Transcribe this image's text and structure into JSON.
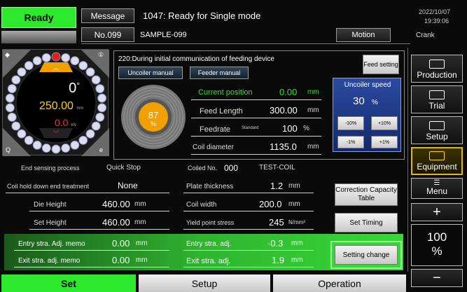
{
  "header": {
    "status": "Ready",
    "message_label": "Message",
    "message_text": "1047: Ready for Single mode",
    "date": "2022/10/07",
    "time": "19:39:06",
    "program_no": "No.099",
    "program_name": "SAMPLE-099",
    "motion_label": "Motion",
    "motion_value": "Crank"
  },
  "gauge": {
    "angle": "0",
    "angle_unit": "°",
    "position": "250.00",
    "position_unit": "mm",
    "load": "0.0",
    "load_unit": "kN",
    "percent": "87",
    "percent_unit": "%"
  },
  "feed": {
    "comm_message": "220:During initial communication of feeding device",
    "uncoiler_manual": "Uncoiler manual",
    "feeder_manual": "Feeder manual",
    "feed_setting": "Feed setting",
    "current_position_label": "Current position",
    "current_position": "0.00",
    "current_position_unit": "mm",
    "feed_length_label": "Feed Length",
    "feed_length": "300.00",
    "feed_length_unit": "mm",
    "feedrate_label": "Feedrate",
    "feedrate_mode": "Standard",
    "feedrate": "100",
    "feedrate_unit": "%",
    "coil_diameter_label": "Coil diameter",
    "coil_diameter": "1135.0",
    "coil_diameter_unit": "mm"
  },
  "uncoiler": {
    "title": "Uncoiler speed",
    "value": "30",
    "unit": "%",
    "btn_m10": "-10%",
    "btn_p10": "+10%",
    "btn_m1": "-1%",
    "btn_p1": "+1%"
  },
  "left_params": {
    "end_sensing_label": "End sensing process",
    "end_sensing": "Quick Stop",
    "coil_hold_label": "Coil hold down end treatment",
    "coil_hold": "None",
    "die_height_label": "Die Height",
    "die_height": "460.00",
    "die_height_unit": "mm",
    "set_height_label": "Set Height",
    "set_height": "460.00",
    "set_height_unit": "mm",
    "entry_memo_label": "Entry stra. Adj. memo",
    "entry_memo": "0.00",
    "entry_memo_unit": "mm",
    "exit_memo_label": "Exit stra. adj. memo",
    "exit_memo": "0.00",
    "exit_memo_unit": "mm"
  },
  "right_params": {
    "coiled_no_label": "Coiled No.",
    "coiled_no": "000",
    "coiled_name": "TEST-COIL",
    "plate_thickness_label": "Plate thickness",
    "plate_thickness": "1.2",
    "plate_thickness_unit": "mm",
    "coil_width_label": "Coil width",
    "coil_width": "200.0",
    "coil_width_unit": "mm",
    "yield_label": "Yield point stress",
    "yield": "245",
    "yield_unit": "N/mm²",
    "entry_adj_label": "Entry stra. adj.",
    "entry_adj": "-0.3",
    "entry_adj_unit": "mm",
    "exit_adj_label": "Exit stra. adj.",
    "exit_adj": "1.9",
    "exit_adj_unit": "mm"
  },
  "actions": {
    "correction": "Correction Capacity Table",
    "set_timing": "Set Timing",
    "setting_change": "Setting change"
  },
  "sidebar": {
    "production": "Production",
    "trial": "Trial",
    "setup": "Setup",
    "equipment": "Equipment",
    "menu": "Menu",
    "plus": "+",
    "value": "100",
    "value_unit": "%",
    "minus": "−"
  },
  "bottom_tabs": {
    "set": "Set",
    "setup": "Setup",
    "operation": "Operation"
  },
  "colors": {
    "status_green": "#2ee82e",
    "accent_green": "#2fe02f",
    "panel_blue": "#1d3b8a",
    "gauge_orange": "#f0a000",
    "yellow_value": "#ffd300",
    "red_value": "#ff3030"
  }
}
